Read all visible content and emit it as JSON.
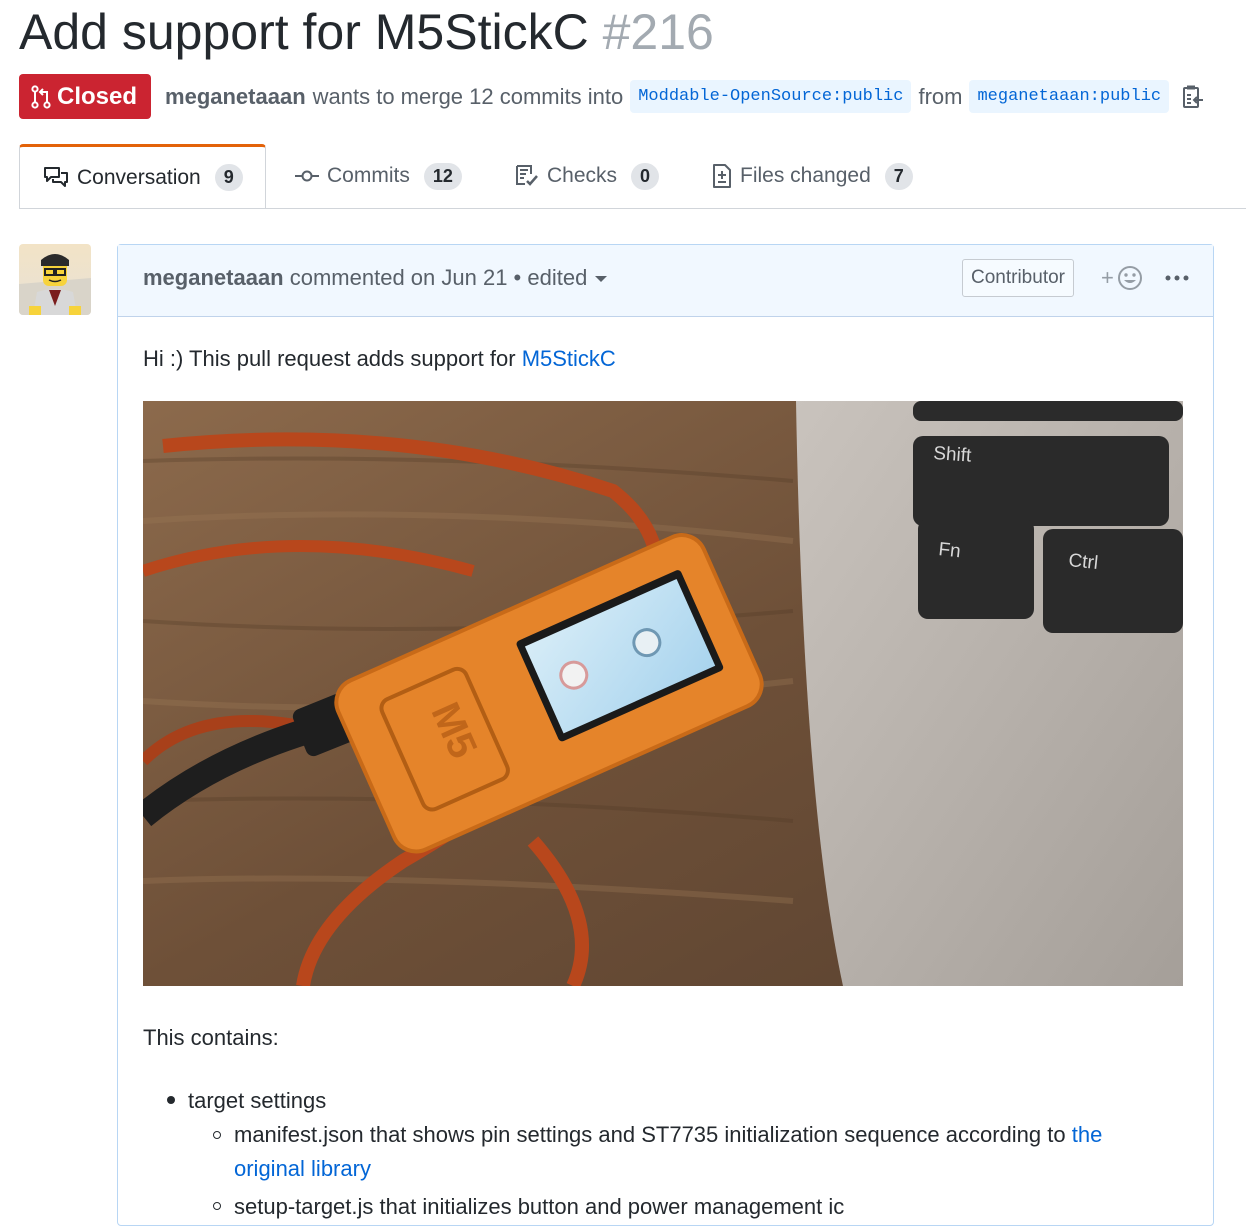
{
  "pr": {
    "title": "Add support for M5StickC",
    "number": "#216",
    "state": "Closed",
    "author": "meganetaaan",
    "merge_text": "wants to merge 12 commits into",
    "base_branch": "Moddable-OpenSource:public",
    "from_text": "from",
    "head_branch": "meganetaaan:public"
  },
  "tabs": [
    {
      "label": "Conversation",
      "count": "9"
    },
    {
      "label": "Commits",
      "count": "12"
    },
    {
      "label": "Checks",
      "count": "0"
    },
    {
      "label": "Files changed",
      "count": "7"
    }
  ],
  "comment": {
    "author": "meganetaaan",
    "meta": "commented on Jun 21 • edited",
    "role": "Contributor",
    "react_plus": "+",
    "intro": "Hi :) This pull request adds support for",
    "intro_link": "M5StickC",
    "photo_labels": {
      "shift": "Shift",
      "fn": "Fn",
      "ctrl": "Ctrl",
      "m5": "M5"
    },
    "contains": "This contains:",
    "list": {
      "item1": "target settings",
      "item2_text": "manifest.json that shows pin settings and ST7735 initialization sequence according to",
      "item2_link": "the original library",
      "item3": "setup-target.js that initializes button and power management ic"
    }
  },
  "colors": {
    "closed": "#cb2431",
    "link": "#0366d6",
    "tab_accent": "#e36209",
    "header_bg": "#f1f8ff"
  }
}
